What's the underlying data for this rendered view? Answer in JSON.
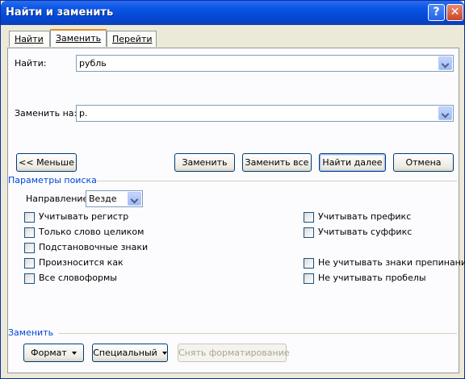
{
  "window": {
    "title": "Найти и заменить",
    "help_icon_glyph": "?",
    "close_icon_glyph": "✕"
  },
  "tabs": [
    {
      "label": "Найти",
      "active": false
    },
    {
      "label": "Заменить",
      "active": true
    },
    {
      "label": "Перейти",
      "active": false
    }
  ],
  "find": {
    "label": "Найти:",
    "value": "рубль"
  },
  "replace": {
    "label": "Заменить на:",
    "value": "р."
  },
  "buttons": {
    "less": "<< Меньше",
    "replace": "Заменить",
    "replace_all": "Заменить все",
    "find_next": "Найти далее",
    "cancel": "Отмена"
  },
  "search_options": {
    "title": "Параметры поиска",
    "direction_label": "Направление:",
    "direction_value": "Везде",
    "left_checks": [
      {
        "label": "Учитывать регистр",
        "checked": false
      },
      {
        "label": "Только слово целиком",
        "checked": false
      },
      {
        "label": "Подстановочные знаки",
        "checked": false
      },
      {
        "label": "Произносится как",
        "checked": false
      },
      {
        "label": "Все словоформы",
        "checked": false
      }
    ],
    "right_checks": [
      {
        "label": "Учитывать префикс",
        "checked": false
      },
      {
        "label": "Учитывать суффикс",
        "checked": false
      },
      {
        "label": "Не учитывать знаки препинания",
        "checked": false
      },
      {
        "label": "Не учитывать пробелы",
        "checked": false
      }
    ]
  },
  "replace_section": {
    "title": "Заменить",
    "format": "Формат",
    "special": "Специальный",
    "clear_formatting": "Снять форматирование"
  },
  "colors": {
    "titlebar": "#0b56e5",
    "group_title": "#0046d5",
    "dialog_bg": "#ece9d8"
  }
}
